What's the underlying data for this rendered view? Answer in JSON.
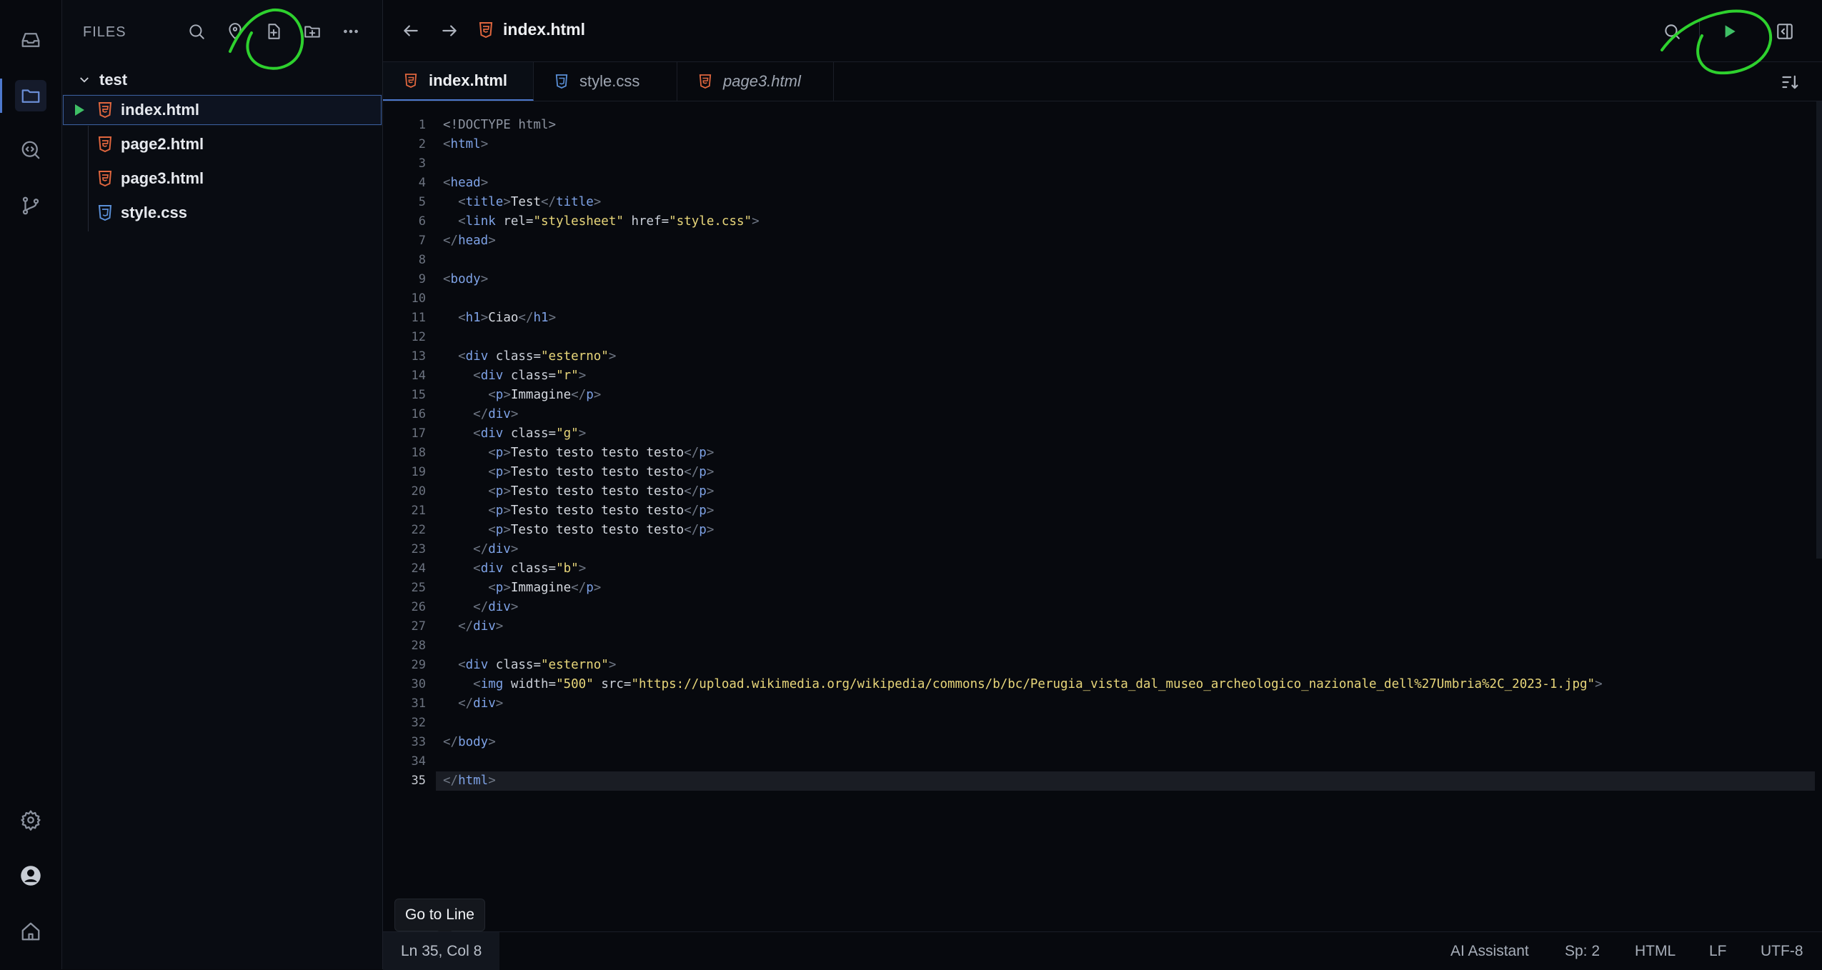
{
  "sidebar": {
    "title": "FILES",
    "folder": "test",
    "files": [
      {
        "name": "index.html",
        "type": "html"
      },
      {
        "name": "page2.html",
        "type": "html"
      },
      {
        "name": "page3.html",
        "type": "html"
      },
      {
        "name": "style.css",
        "type": "css"
      }
    ]
  },
  "topbar": {
    "current_file": "index.html"
  },
  "tabs": [
    {
      "label": "index.html",
      "type": "html"
    },
    {
      "label": "style.css",
      "type": "css"
    },
    {
      "label": "page3.html",
      "type": "html"
    }
  ],
  "code": {
    "line_numbers": [
      "1",
      "2",
      "3",
      "4",
      "5",
      "6",
      "7",
      "8",
      "9",
      "10",
      "11",
      "12",
      "13",
      "14",
      "15",
      "16",
      "17",
      "18",
      "19",
      "20",
      "21",
      "22",
      "23",
      "24",
      "25",
      "26",
      "27",
      "28",
      "29",
      "30",
      "31",
      "32",
      "33",
      "34",
      "35"
    ],
    "current_line": 35
  },
  "tooltip": {
    "text": "Go to Line"
  },
  "status": {
    "position": "Ln 35, Col 8",
    "ai": "AI Assistant",
    "spaces": "Sp: 2",
    "language": "HTML",
    "eol": "LF",
    "encoding": "UTF-8"
  },
  "colors": {
    "html_icon": "#e0663e",
    "css_icon": "#5a8fd6",
    "annotation": "#2ed12e",
    "accent": "#4d78cc"
  }
}
